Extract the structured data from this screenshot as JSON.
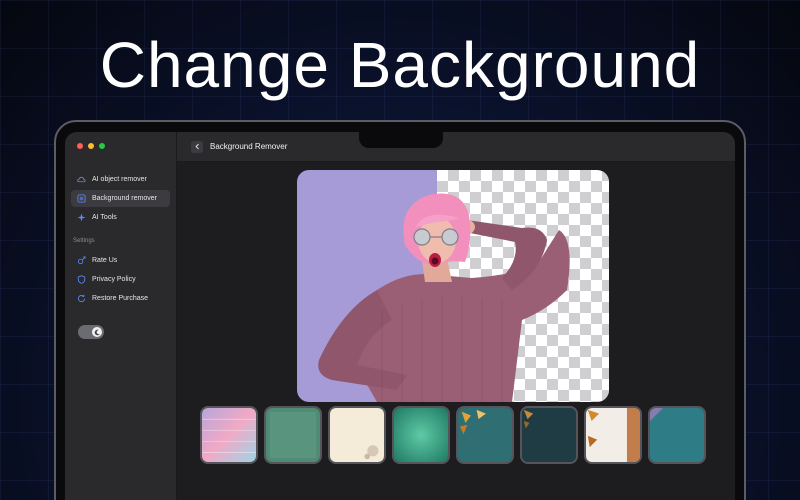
{
  "headline": "Change Background",
  "window": {
    "traffic_colors": [
      "#ff5f57",
      "#febc2e",
      "#28c840"
    ],
    "title": "Background Remover"
  },
  "sidebar": {
    "items": [
      {
        "label": "AI object remover",
        "icon": "cloud-edit-icon"
      },
      {
        "label": "Background remover",
        "icon": "layers-icon",
        "active": true
      },
      {
        "label": "AI Tools",
        "icon": "sparkles-icon"
      }
    ],
    "settings_label": "Settings",
    "settings_items": [
      {
        "label": "Rate Us",
        "icon": "rate-icon"
      },
      {
        "label": "Privacy Policy",
        "icon": "shield-icon"
      },
      {
        "label": "Restore Purchase",
        "icon": "restore-icon"
      }
    ],
    "theme_toggle": "dark-mode-toggle"
  },
  "colors": {
    "accent_blue": "#5b8cff",
    "photo_background": "#a69bd6",
    "sweater": "#9a5f75"
  },
  "backgrounds": [
    "rainbow-brick-wall",
    "green-texture",
    "cream-floral",
    "teal-gradient",
    "teal-autumn-leaves",
    "dark-teal-leaves",
    "white-autumn-leaves",
    "teal-paper-corner"
  ]
}
